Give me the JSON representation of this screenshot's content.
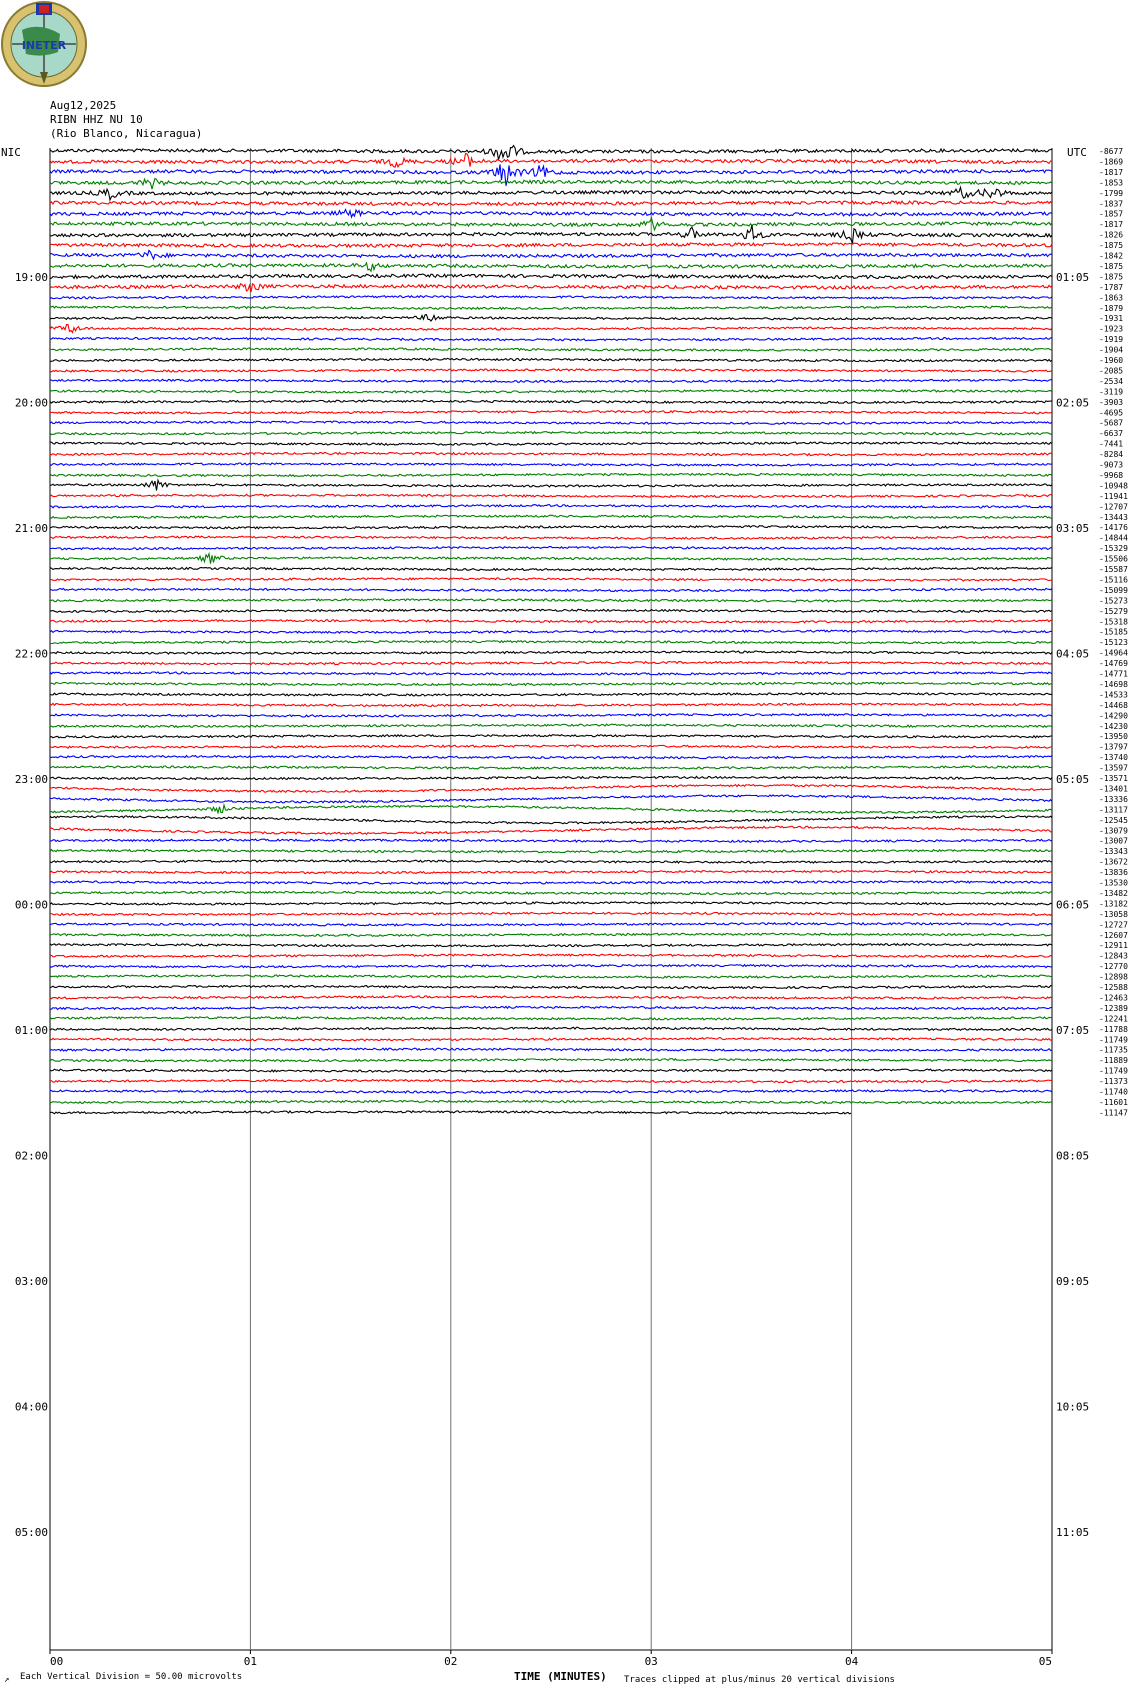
{
  "header": {
    "date": "Aug12,2025",
    "station": "RIBN HHZ NU 10",
    "location": "(Rio Blanco, Nicaragua)",
    "left_tz": "NIC",
    "right_tz": "UTC"
  },
  "logo": {
    "text": "INETER",
    "colors": {
      "ring": "#c8b060",
      "globe": "#a8d8c8",
      "land": "#3a8a4a",
      "flag": "#1a3aaa"
    }
  },
  "footer": {
    "scale_note": "Each Vertical Division =   50.00 microvolts",
    "clip_note": "Traces clipped at plus/minus 20 vertical divisions"
  },
  "chart_data": {
    "type": "line",
    "subtype": "helicorder",
    "xlabel": "TIME (MINUTES)",
    "x_ticks": [
      "00",
      "01",
      "02",
      "03",
      "04",
      "05"
    ],
    "xlim": [
      0,
      5
    ],
    "trace_colors": [
      "#000000",
      "#ff0000",
      "#0000ff",
      "#008000"
    ],
    "left_hour_labels": [
      "19:00",
      "20:00",
      "21:00",
      "22:00",
      "23:00",
      "00:00",
      "01:00",
      "02:00",
      "03:00",
      "04:00",
      "05:00"
    ],
    "right_hour_labels": [
      "01:05",
      "02:05",
      "03:05",
      "04:05",
      "05:05",
      "06:05",
      "07:05",
      "08:05",
      "09:05",
      "10:05",
      "11:05"
    ],
    "trace_offsets": [
      -8677,
      -1869,
      -1817,
      -1853,
      -1799,
      -1837,
      -1857,
      -1817,
      -1826,
      -1875,
      -1842,
      -1875,
      -1875,
      -1787,
      -1863,
      -1879,
      -1931,
      -1923,
      -1919,
      -1904,
      -1960,
      -2085,
      -2534,
      -3119,
      -3903,
      -4695,
      -5687,
      -6637,
      -7441,
      -8284,
      -9073,
      -9968,
      -10948,
      -11941,
      -12707,
      -13443,
      -14176,
      -14844,
      -15329,
      -15506,
      -15587,
      -15116,
      -15099,
      -15273,
      -15279,
      -15318,
      -15185,
      -15123,
      -14964,
      -14769,
      -14771,
      -14698,
      -14533,
      -14468,
      -14290,
      -14230,
      -13950,
      -13797,
      -13740,
      -13597,
      -13571,
      -13401,
      -13336,
      -13117,
      -12545,
      -13079,
      -13007,
      -13343,
      -13672,
      -13836,
      -13530,
      -13482,
      -13182,
      -13058,
      -12727,
      -12607,
      -12911,
      -12843,
      -12770,
      -12898,
      -12588,
      -12463,
      -12389,
      -12241,
      -11788,
      -11749,
      -11735,
      -11889,
      -11749,
      -11373,
      -11740,
      -11601,
      -11147
    ],
    "events": [
      {
        "trace": 0,
        "minute": 2.27,
        "amplitude": 6
      },
      {
        "trace": 1,
        "minute": 2.07,
        "amplitude": 3
      },
      {
        "trace": 1,
        "minute": 1.73,
        "amplitude": 2
      },
      {
        "trace": 2,
        "minute": 2.27,
        "amplitude": 5
      },
      {
        "trace": 2,
        "minute": 2.45,
        "amplitude": 2.5
      },
      {
        "trace": 3,
        "minute": 0.5,
        "amplitude": 2
      },
      {
        "trace": 4,
        "minute": 0.3,
        "amplitude": 2
      },
      {
        "trace": 4,
        "minute": 4.7,
        "amplitude": 2.5
      },
      {
        "trace": 4,
        "minute": 4.55,
        "amplitude": 2
      },
      {
        "trace": 6,
        "minute": 1.5,
        "amplitude": 1.5
      },
      {
        "trace": 7,
        "minute": 3.0,
        "amplitude": 2
      },
      {
        "trace": 8,
        "minute": 3.5,
        "amplitude": 3
      },
      {
        "trace": 8,
        "minute": 3.2,
        "amplitude": 2
      },
      {
        "trace": 8,
        "minute": 4.0,
        "amplitude": 2.5
      },
      {
        "trace": 10,
        "minute": 0.5,
        "amplitude": 1.5
      },
      {
        "trace": 11,
        "minute": 1.6,
        "amplitude": 1.5
      },
      {
        "trace": 13,
        "minute": 1.0,
        "amplitude": 2
      },
      {
        "trace": 16,
        "minute": 1.9,
        "amplitude": 1.5
      },
      {
        "trace": 17,
        "minute": 0.1,
        "amplitude": 2
      },
      {
        "trace": 32,
        "minute": 0.53,
        "amplitude": 2
      },
      {
        "trace": 39,
        "minute": 0.8,
        "amplitude": 2
      },
      {
        "trace": 63,
        "minute": 0.85,
        "amplitude": 1.5
      }
    ]
  }
}
